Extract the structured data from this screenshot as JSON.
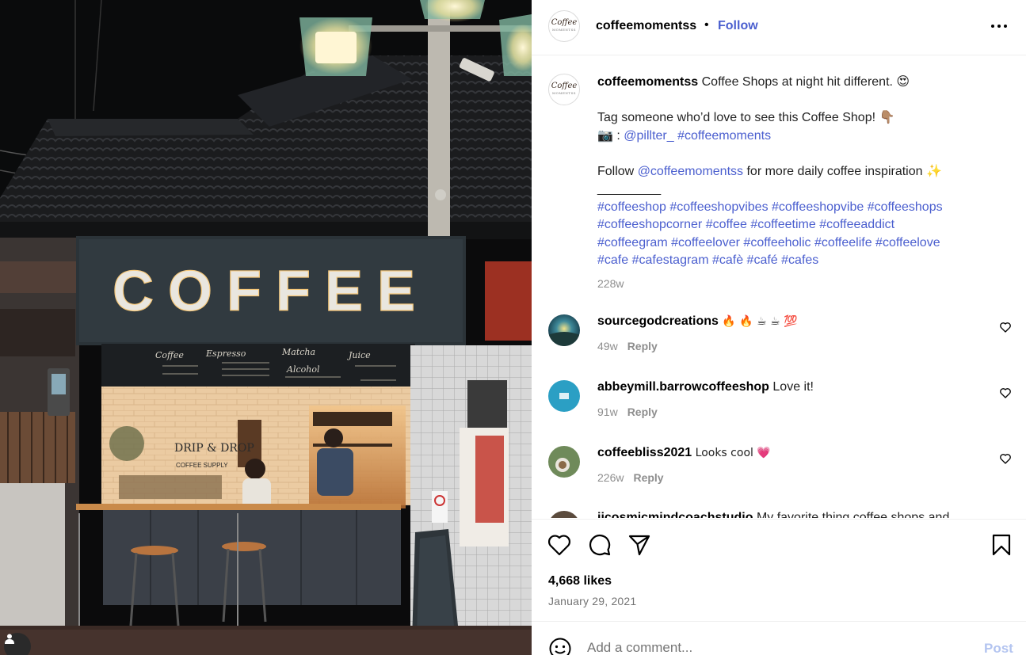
{
  "post": {
    "username": "coffeemomentss",
    "follow_label": "Follow",
    "separator": "•",
    "avatar_logo": "Coffee",
    "avatar_logo_sub": "MOMENTSS",
    "photo_sign_text": "COFFEE",
    "photo_menu_labels": [
      "Coffee",
      "Espresso",
      "Matcha",
      "Juice",
      "Alcohol"
    ],
    "photo_storefront_text": "DRIP & DROP",
    "photo_storefront_sub": "COFFEE SUPPLY"
  },
  "caption": {
    "username": "coffeemomentss",
    "line1": "Coffee Shops at night hit different. 😍",
    "line2": "Tag someone who’d love to see this Coffee Shop! 👇🏽",
    "camera": "📷 : ",
    "credit_handle": "@pillter_",
    "credit_tag": "#coffeemoments",
    "follow_prefix": "Follow ",
    "follow_handle": "@coffeemomentss",
    "follow_suffix": " for more daily coffee inspiration ✨",
    "divider": "_________",
    "hashtags_1": "#coffeeshop #coffeeshopvibes #coffeeshopvibe #coffeeshops",
    "hashtags_2": "#coffeeshopcorner #coffee #coffeetime #coffeeaddict",
    "hashtags_3": "#coffeegram #coffeelover #coffeeholic #coffeelife #coffeelove",
    "hashtags_4": "#cafe #cafestagram #cafè #café #cafes",
    "time": "228w"
  },
  "comments": [
    {
      "username": "sourcegodcreations",
      "text": "🔥 🔥 ☕ ☕ 💯",
      "time": "49w",
      "reply": "Reply"
    },
    {
      "username": "abbeymill.barrowcoffeeshop",
      "text": "Love it!",
      "time": "91w",
      "reply": "Reply"
    },
    {
      "username": "coffeebliss2021",
      "text": "Looks cool 💗",
      "time": "226w",
      "reply": "Reply"
    },
    {
      "username": "jjcosmicmindcoachstudio",
      "text": "My favorite thing coffee shops and",
      "time": "",
      "reply": ""
    }
  ],
  "actions": {
    "likes": "4,668 likes",
    "date": "January 29, 2021"
  },
  "comment_box": {
    "placeholder": "Add a comment...",
    "post_label": "Post"
  },
  "icons": [
    "more-icon",
    "heart-icon",
    "comment-icon",
    "share-icon",
    "bookmark-icon",
    "emoji-icon",
    "user-tag-icon"
  ],
  "colors": {
    "link": "#4b5fcf",
    "muted": "#8e8e8e",
    "post_disabled": "#b3c4f0"
  }
}
